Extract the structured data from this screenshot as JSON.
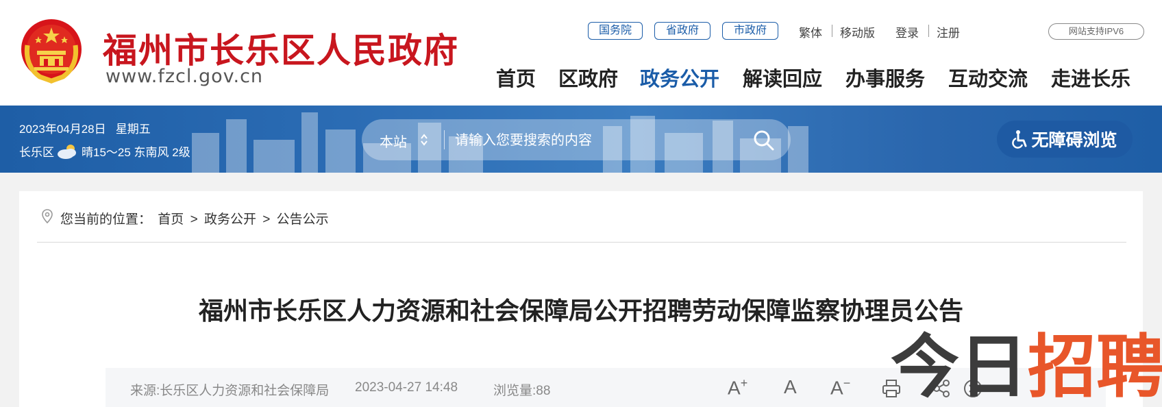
{
  "header": {
    "site_title": "福州市长乐区人民政府",
    "site_url": "www.fzcl.gov.cn",
    "top_links": [
      "国务院",
      "省政府",
      "市政府"
    ],
    "utility": {
      "traditional": "繁体",
      "mobile": "移动版",
      "login": "登录",
      "register": "注册",
      "ipv6": "网站支持IPV6"
    },
    "nav": [
      "首页",
      "区政府",
      "政务公开",
      "解读回应",
      "办事服务",
      "互动交流",
      "走进长乐"
    ],
    "active_nav": "政务公开"
  },
  "banner": {
    "date": "2023年04月28日",
    "weekday": "星期五",
    "district": "长乐区",
    "weather": "晴15～25 东南风 2级",
    "search": {
      "scope": "本站",
      "placeholder": "请输入您要搜索的内容"
    },
    "accessibility_label": "无障碍浏览"
  },
  "breadcrumb": {
    "prefix": "您当前的位置：",
    "items": [
      "首页",
      ">",
      "政务公开",
      ">",
      "公告公示"
    ]
  },
  "article": {
    "title": "福州市长乐区人力资源和社会保障局公开招聘劳动保障监察协理员公告",
    "source": "来源:长乐区人力资源和社会保障局",
    "datetime": "2023-04-27 14:48",
    "views": "浏览量:88"
  },
  "tools": {
    "font_large": "A",
    "font_normal": "A",
    "font_small": "A",
    "plus": "+",
    "minus": "−"
  },
  "watermark": {
    "part1": "今日",
    "part2": "招聘"
  },
  "colors": {
    "brand_red": "#c8161e",
    "brand_blue": "#1a5ca8",
    "watermark_orange": "#e8562a"
  }
}
